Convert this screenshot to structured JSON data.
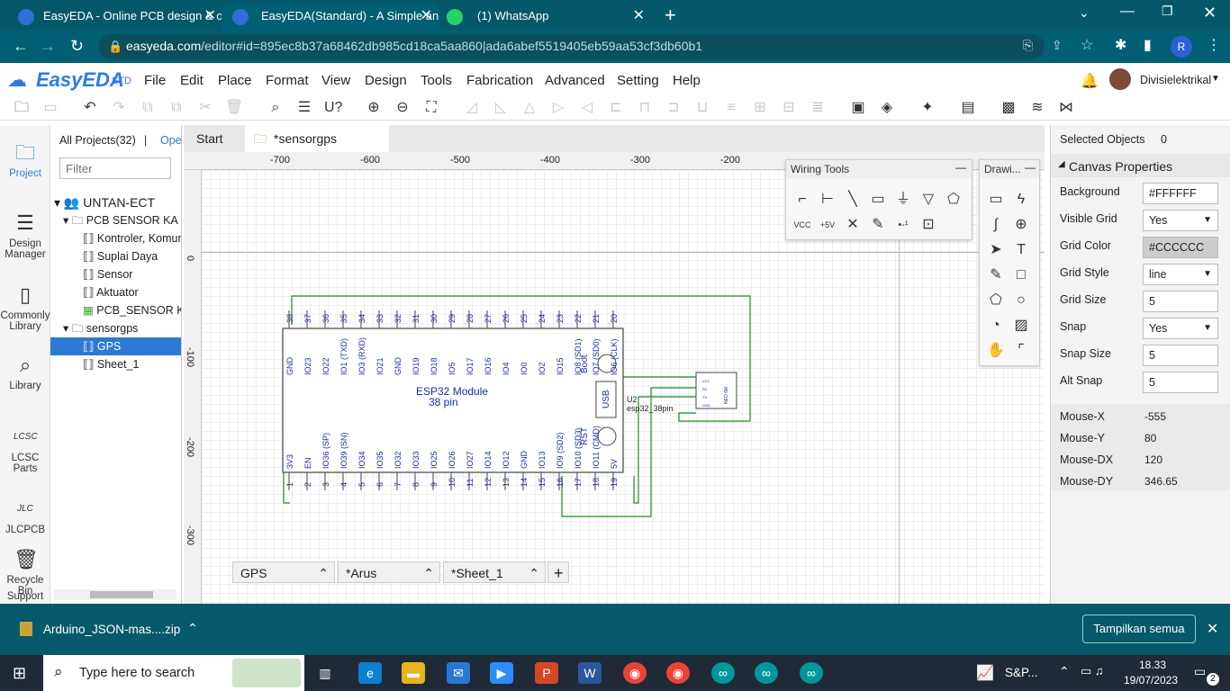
{
  "browser": {
    "tabs": [
      {
        "title": "EasyEDA - Online PCB design & c"
      },
      {
        "title": "EasyEDA(Standard) - A Simple an"
      },
      {
        "title": "(1) WhatsApp"
      }
    ],
    "url_domain": "easyeda.com",
    "url_path": "/editor#id=895ec8b37a68462db985cd18ca5aa860|ada6abef5519405eb59aa53cf3db60b1",
    "profile_initial": "R"
  },
  "app": {
    "logo": "EasyEDA",
    "logo_suffix": "STD",
    "menu": [
      "File",
      "Edit",
      "Place",
      "Format",
      "View",
      "Design",
      "Tools",
      "Fabrication",
      "Advanced",
      "Setting",
      "Help"
    ],
    "user": "Divisielektrikal"
  },
  "rail": [
    "Project",
    "Design Manager",
    "Commonly Library",
    "Library",
    "LCSC Parts",
    "JLCPCB",
    "Recycle Bin",
    "Support"
  ],
  "tree": {
    "header": "All Projects(32)",
    "sep": "|",
    "open": "Ope",
    "filter_placeholder": "Filter",
    "nodes": [
      "UNTAN-ECT",
      "PCB SENSOR KA",
      "Kontroler, Komun",
      "Suplai Daya",
      "Sensor",
      "Aktuator",
      "PCB_SENSOR K",
      "sensorgps",
      "GPS",
      "Sheet_1"
    ]
  },
  "doc_tabs": [
    "Start",
    "*sensorgps"
  ],
  "ruler": {
    "x": [
      "-700",
      "-600",
      "-500",
      "-400",
      "-300",
      "-200"
    ],
    "y": [
      "0",
      "-100",
      "-200",
      "-300"
    ]
  },
  "panels": {
    "wiring": "Wiring Tools",
    "drawing": "Drawi..."
  },
  "schematic": {
    "module_title": "ESP32 Module",
    "module_sub": "38 pin",
    "usb": "USB",
    "boot": "Boot",
    "rst": "RST",
    "designator": "U2",
    "partname": "esp32_38pin",
    "gps_label": "NEO 6M",
    "gps_pins": [
      "VCC",
      "RX",
      "TX",
      "GND"
    ],
    "top_pin_numbers": [
      "38",
      "37",
      "36",
      "35",
      "34",
      "33",
      "32",
      "31",
      "30",
      "29",
      "28",
      "27",
      "26",
      "25",
      "24",
      "23",
      "22",
      "21",
      "20"
    ],
    "top_pin_names": [
      "GND",
      "IO23",
      "IO22",
      "IO1 (TXD)",
      "IO3 (RXD)",
      "IO21",
      "GND",
      "IO19",
      "IO18",
      "IO5",
      "IO17",
      "IO16",
      "IO4",
      "IO0",
      "IO2",
      "IO15",
      "IO8 (SD1)",
      "IO7 (SD0)",
      "IO6 (CLK)"
    ],
    "bot_pin_numbers": [
      "1",
      "2",
      "3",
      "4",
      "5",
      "6",
      "7",
      "8",
      "9",
      "10",
      "11",
      "12",
      "13",
      "14",
      "15",
      "16",
      "17",
      "18",
      "19"
    ],
    "bot_pin_names": [
      "3V3",
      "EN",
      "IO36 (SP)",
      "IO39 (SN)",
      "IO34",
      "IO35",
      "IO32",
      "IO33",
      "IO25",
      "IO26",
      "IO27",
      "IO14",
      "IO12",
      "GND",
      "IO13",
      "IO9 (SD2)",
      "IO10 (SD3)",
      "IO11 (CMD)",
      "5V"
    ]
  },
  "sheet_tabs": [
    "GPS",
    "*Arus",
    "*Sheet_1"
  ],
  "props": {
    "selected_label": "Selected Objects",
    "selected_count": "0",
    "section": "Canvas Properties",
    "rows": [
      {
        "label": "Background",
        "value": "#FFFFFF"
      },
      {
        "label": "Visible Grid",
        "value": "Yes"
      },
      {
        "label": "Grid Color",
        "value": "#CCCCCC"
      },
      {
        "label": "Grid Style",
        "value": "line"
      },
      {
        "label": "Grid Size",
        "value": "5"
      },
      {
        "label": "Snap",
        "value": "Yes"
      },
      {
        "label": "Snap Size",
        "value": "5"
      },
      {
        "label": "Alt Snap",
        "value": "5"
      }
    ],
    "mouse": [
      {
        "label": "Mouse-X",
        "value": "-555"
      },
      {
        "label": "Mouse-Y",
        "value": "80"
      },
      {
        "label": "Mouse-DX",
        "value": "120"
      },
      {
        "label": "Mouse-DY",
        "value": "346.65"
      }
    ]
  },
  "download": {
    "file": "Arduino_JSON-mas....zip",
    "show_all": "Tampilkan semua"
  },
  "taskbar": {
    "search": "Type here to search",
    "weather": "S&P...",
    "time": "18.33",
    "date": "19/07/2023",
    "notif_count": "2"
  }
}
